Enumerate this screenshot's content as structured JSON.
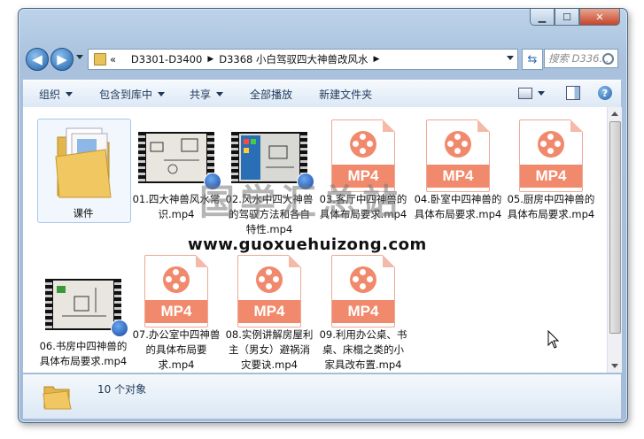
{
  "window": {
    "controls": {
      "minimize": "▁",
      "maximize": "☐",
      "close": "✕"
    }
  },
  "nav": {
    "back_icon": "back-arrow-icon",
    "forward_icon": "forward-arrow-icon",
    "address_prefix": "«",
    "breadcrumbs": [
      "D3301-D3400",
      "D3368 小白驾驭四大神兽改风水"
    ],
    "search_placeholder": "搜索 D336..."
  },
  "toolbar": {
    "organize": "组织",
    "include_in_library": "包含到库中",
    "share": "共享",
    "play_all": "全部播放",
    "new_folder": "新建文件夹"
  },
  "files": [
    {
      "name": "课件",
      "type": "folder"
    },
    {
      "name": "01.四大神兽风水常识.mp4",
      "type": "video-thumb"
    },
    {
      "name": "02.风水中四大神兽的驾驭方法和各自特性.mp4",
      "type": "video-thumb"
    },
    {
      "name": "03.客厅中四神兽的具体布局要求.mp4",
      "type": "mp4"
    },
    {
      "name": "04.卧室中四神兽的具体布局要求.mp4",
      "type": "mp4"
    },
    {
      "name": "05.厨房中四神兽的具体布局要求.mp4",
      "type": "mp4"
    },
    {
      "name": "06.书房中四神兽的具体布局要求.mp4",
      "type": "video-thumb"
    },
    {
      "name": "07.办公室中四神兽的具体布局要求.mp4",
      "type": "mp4"
    },
    {
      "name": "08.实例讲解房屋利主（男女）避祸消灾要诀.mp4",
      "type": "mp4"
    },
    {
      "name": "09.利用办公桌、书桌、床榻之类的小家具改布置.mp4",
      "type": "mp4"
    }
  ],
  "mp4_label": "MP4",
  "watermark": {
    "cn": "国学汇总站",
    "url": "www.guoxuehuizong.com"
  },
  "status": {
    "count_text": "10 个对象"
  }
}
